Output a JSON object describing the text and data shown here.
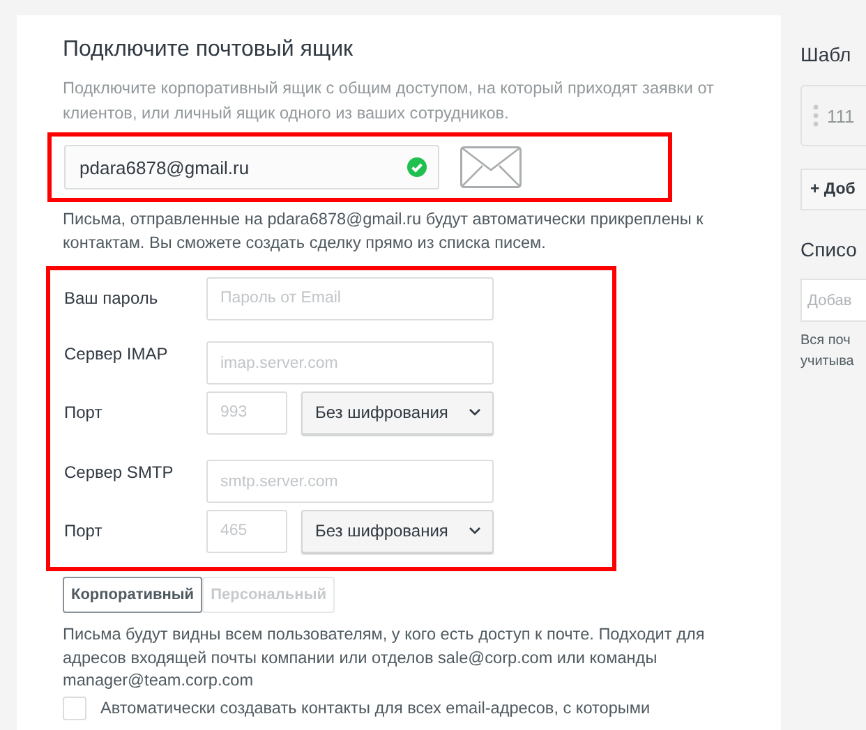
{
  "mailbox": {
    "title": "Подключите почтовый ящик",
    "description": "Подключите корпоративный ящик с общим доступом, на который приходят заявки от клиентов, или личный ящик одного из ваших сотрудников.",
    "email": {
      "value": "pdara6878@gmail.ru",
      "valid": true
    },
    "note": "Письма, отправленные на pdara6878@gmail.ru будут автоматически прикреплены к контактам. Вы сможете создать сделку прямо из списка писем."
  },
  "settings": [
    {
      "kind": "password",
      "label": "Ваш пароль",
      "placeholder": "Пароль от Email"
    },
    {
      "kind": "text",
      "label": "Сервер IMAP",
      "placeholder": "imap.server.com"
    },
    {
      "kind": "port",
      "label": "Порт",
      "placeholder": "993",
      "encryption": "Без шифрования"
    },
    {
      "kind": "text",
      "label": "Сервер SMTP",
      "placeholder": "smtp.server.com"
    },
    {
      "kind": "port",
      "label": "Порт",
      "placeholder": "465",
      "encryption": "Без шифрования"
    }
  ],
  "mode_tabs": [
    {
      "label": "Корпоративный",
      "selected": true
    },
    {
      "label": "Персональный",
      "selected": false
    }
  ],
  "mode_description": "Письма будут видны всем пользователям, у кого есть доступ к почте. Подходит для адресов входящей почты компании или отделов sale@corp.com или команды manager@team.corp.com",
  "auto_contacts": {
    "label": "Автоматически создавать контакты для всех email-адресов, с которыми",
    "checked": false
  },
  "side": {
    "templates_title": "Шабл",
    "template_item": "111",
    "add_button": "+ Доб",
    "list_title": "Списо",
    "list_placeholder": "Добав",
    "list_note": [
      "Вся поч",
      "учитыва"
    ]
  }
}
